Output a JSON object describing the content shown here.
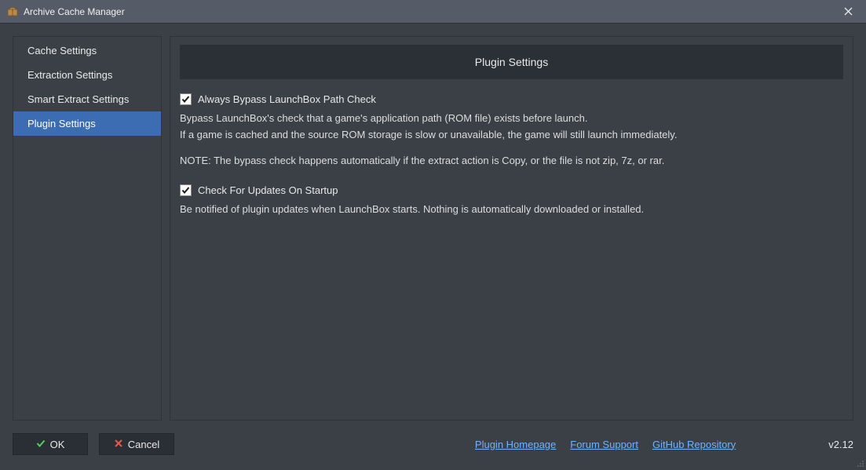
{
  "window": {
    "title": "Archive Cache Manager"
  },
  "sidebar": {
    "items": [
      {
        "label": "Cache Settings"
      },
      {
        "label": "Extraction Settings"
      },
      {
        "label": "Smart Extract Settings"
      },
      {
        "label": "Plugin Settings"
      }
    ],
    "selected_index": 3
  },
  "content": {
    "header": "Plugin Settings",
    "options": [
      {
        "checked": true,
        "label": "Always Bypass LaunchBox Path Check",
        "desc_line1": "Bypass LaunchBox's check that a game's application path (ROM file) exists before launch.",
        "desc_line2": "If a game is cached and the source ROM storage is slow or unavailable, the game will still launch immediately.",
        "note": "NOTE: The bypass check happens automatically if the extract action is Copy, or the file is not zip, 7z, or rar."
      },
      {
        "checked": true,
        "label": "Check For Updates On Startup",
        "desc_line1": "Be notified of plugin updates when LaunchBox starts. Nothing is automatically downloaded or installed."
      }
    ]
  },
  "footer": {
    "ok_label": "OK",
    "cancel_label": "Cancel",
    "links": [
      {
        "label": "Plugin Homepage"
      },
      {
        "label": "Forum Support"
      },
      {
        "label": "GitHub Repository"
      }
    ],
    "version": "v2.12"
  }
}
